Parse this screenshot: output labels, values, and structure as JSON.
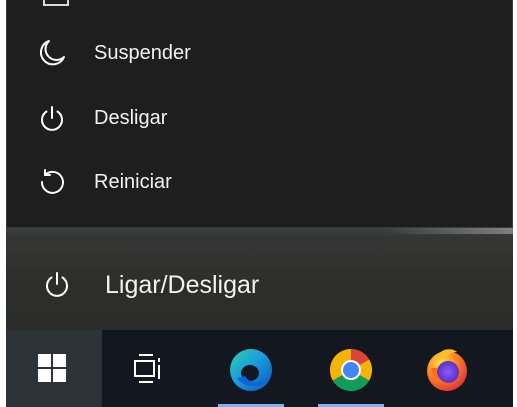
{
  "power_menu": {
    "items": [
      {
        "label": "Suspender",
        "icon": "sleep-moon-icon"
      },
      {
        "label": "Desligar",
        "icon": "power-icon"
      },
      {
        "label": "Reiniciar",
        "icon": "restart-icon"
      }
    ]
  },
  "power_button": {
    "label": "Ligar/Desligar",
    "icon": "power-icon"
  },
  "taskbar": {
    "items": [
      {
        "icon": "windows-logo-icon"
      },
      {
        "icon": "task-view-icon"
      },
      {
        "icon": "edge-icon"
      },
      {
        "icon": "chrome-icon"
      },
      {
        "icon": "firefox-icon"
      }
    ]
  },
  "colors": {
    "menu_background": "#1e1e1e",
    "taskbar_background": "#131720",
    "running_indicator": "#7fb3e8"
  }
}
